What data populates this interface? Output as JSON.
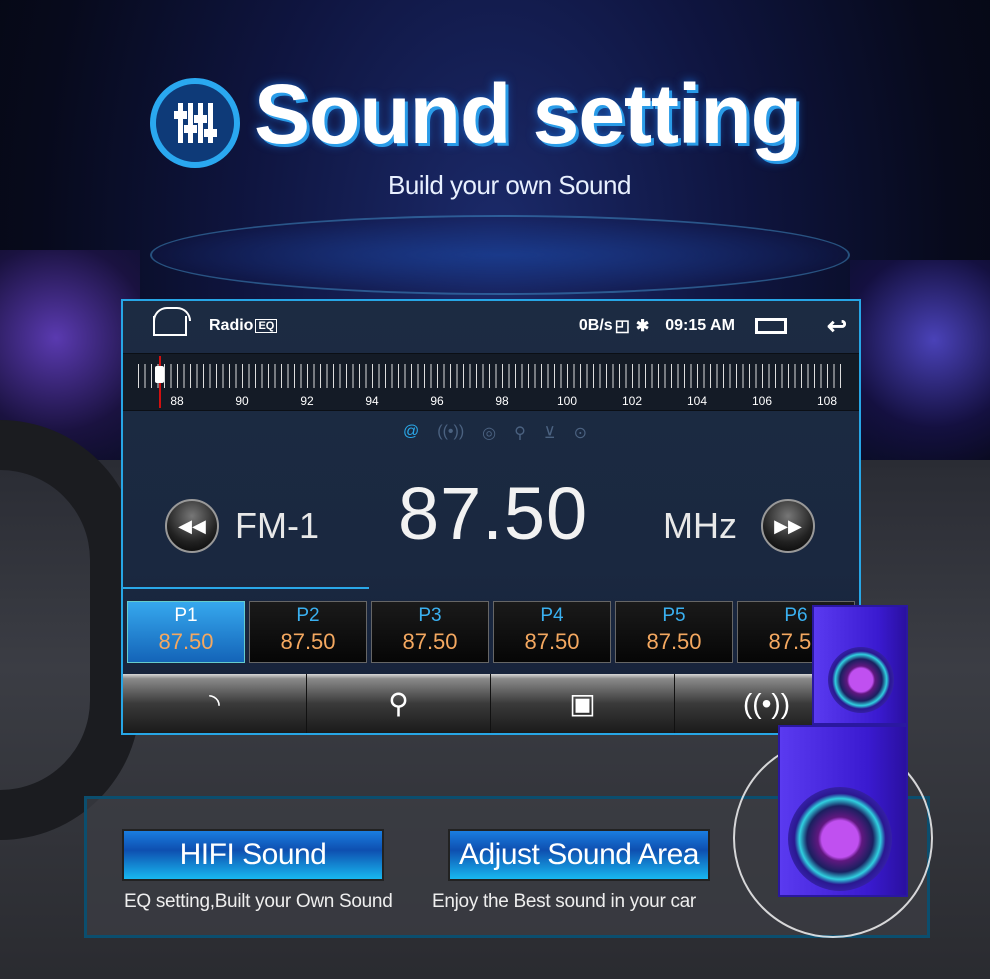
{
  "headline": {
    "title": "Sound setting",
    "subtitle": "Build your own Sound",
    "icon": "equalizer-icon"
  },
  "radio": {
    "status_bar": {
      "app": "Radio",
      "net_speed": "0B/s",
      "time": "09:15 AM",
      "bluetooth_icon": "bluetooth-icon"
    },
    "ruler_labels": [
      "88",
      "90",
      "92",
      "94",
      "96",
      "98",
      "100",
      "102",
      "104",
      "106",
      "108"
    ],
    "mode_icons": [
      "stereo-icon",
      "radio-wave-icon",
      "loop-icon",
      "search-icon",
      "download-icon",
      "local-search-icon"
    ],
    "band": "FM-1",
    "frequency": "87.50",
    "unit": "MHz",
    "presets": [
      {
        "name": "P1",
        "freq": "87.50"
      },
      {
        "name": "P2",
        "freq": "87.50"
      },
      {
        "name": "P3",
        "freq": "87.50"
      },
      {
        "name": "P4",
        "freq": "87.50"
      },
      {
        "name": "P5",
        "freq": "87.50"
      },
      {
        "name": "P6",
        "freq": "87.50"
      }
    ],
    "selected_preset": "P1",
    "toolbar": [
      "rds-icon",
      "search-icon",
      "save-icon",
      "antenna-icon"
    ]
  },
  "features": [
    {
      "label": "HIFI Sound",
      "caption": "EQ setting,Built your Own Sound"
    },
    {
      "label": "Adjust Sound Area",
      "caption": "Enjoy the Best sound in your car"
    }
  ],
  "colors": {
    "accent": "#27a6e6",
    "preset_freq": "#f4a860",
    "speaker": "#5a3af0"
  }
}
